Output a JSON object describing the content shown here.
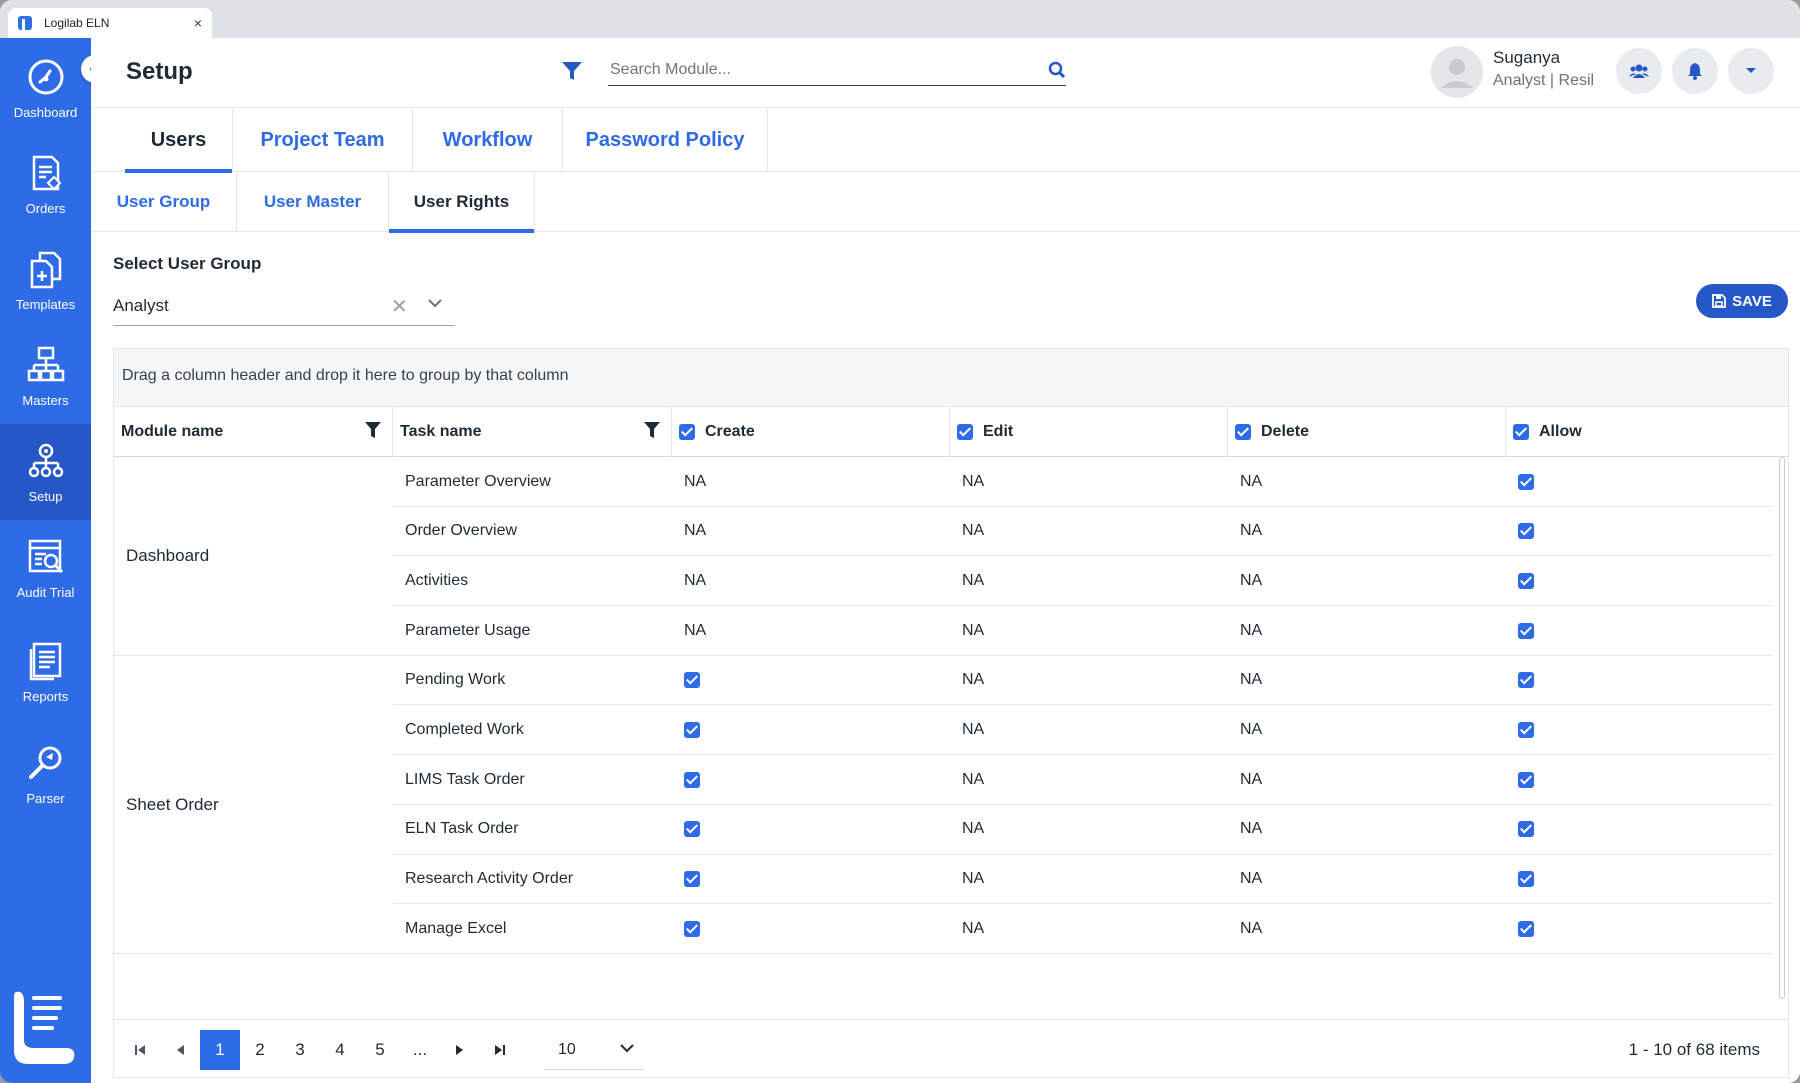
{
  "browser": {
    "tab_title": "Logilab ELN",
    "close": "×"
  },
  "sidebar": {
    "items": [
      {
        "label": "Dashboard",
        "icon": "dashboard-icon"
      },
      {
        "label": "Orders",
        "icon": "orders-icon"
      },
      {
        "label": "Templates",
        "icon": "templates-icon"
      },
      {
        "label": "Masters",
        "icon": "masters-icon"
      },
      {
        "label": "Setup",
        "icon": "setup-icon",
        "active": true
      },
      {
        "label": "Audit Trial",
        "icon": "audit-icon"
      },
      {
        "label": "Reports",
        "icon": "reports-icon"
      },
      {
        "label": "Parser",
        "icon": "parser-icon"
      }
    ]
  },
  "header": {
    "title": "Setup",
    "search_placeholder": "Search Module...",
    "user_name": "Suganya",
    "user_role": "Analyst | Resil"
  },
  "main_tabs": [
    "Users",
    "Project Team",
    "Workflow",
    "Password Policy"
  ],
  "sub_tabs": [
    "User Group",
    "User Master",
    "User Rights"
  ],
  "user_group": {
    "label": "Select User Group",
    "value": "Analyst"
  },
  "save_label": "SAVE",
  "grid": {
    "group_panel_text": "Drag a column header and drop it here to group by that column",
    "columns": [
      "Module name",
      "Task name",
      "Create",
      "Edit",
      "Delete",
      "Allow"
    ],
    "modules": [
      "Dashboard",
      "Sheet Order"
    ],
    "rows": [
      {
        "module": "Dashboard",
        "task": "Parameter Overview",
        "create": "NA",
        "edit": "NA",
        "delete": "NA",
        "allow": true
      },
      {
        "module": "Dashboard",
        "task": "Order Overview",
        "create": "NA",
        "edit": "NA",
        "delete": "NA",
        "allow": true
      },
      {
        "module": "Dashboard",
        "task": "Activities",
        "create": "NA",
        "edit": "NA",
        "delete": "NA",
        "allow": true
      },
      {
        "module": "Dashboard",
        "task": "Parameter Usage",
        "create": "NA",
        "edit": "NA",
        "delete": "NA",
        "allow": true
      },
      {
        "module": "Sheet Order",
        "task": "Pending Work",
        "create": true,
        "edit": "NA",
        "delete": "NA",
        "allow": true
      },
      {
        "module": "Sheet Order",
        "task": "Completed Work",
        "create": true,
        "edit": "NA",
        "delete": "NA",
        "allow": true
      },
      {
        "module": "Sheet Order",
        "task": "LIMS Task Order",
        "create": true,
        "edit": "NA",
        "delete": "NA",
        "allow": true
      },
      {
        "module": "Sheet Order",
        "task": "ELN Task Order",
        "create": true,
        "edit": "NA",
        "delete": "NA",
        "allow": true
      },
      {
        "module": "Sheet Order",
        "task": "Research Activity Order",
        "create": true,
        "edit": "NA",
        "delete": "NA",
        "allow": true
      },
      {
        "module": "Sheet Order",
        "task": "Manage Excel",
        "create": true,
        "edit": "NA",
        "delete": "NA",
        "allow": true
      }
    ]
  },
  "pager": {
    "pages": [
      "1",
      "2",
      "3",
      "4",
      "5",
      "..."
    ],
    "current_page": "1",
    "page_size": "10",
    "info": "1 - 10 of 68 items"
  },
  "colors": {
    "primary": "#2e6be6",
    "sidebar_active": "#2558c6",
    "text": "#1f2a37"
  }
}
